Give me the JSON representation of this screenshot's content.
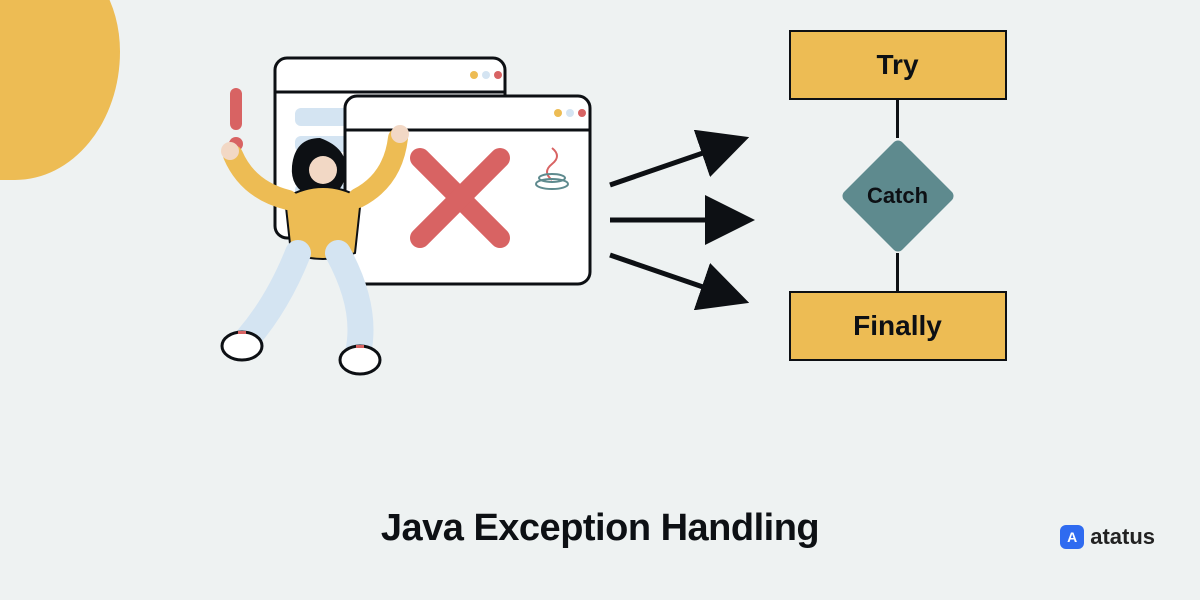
{
  "title": "Java Exception Handling",
  "brand": {
    "name": "atatus",
    "logo_letter": "A"
  },
  "flow": {
    "try_label": "Try",
    "catch_label": "Catch",
    "finally_label": "Finally"
  },
  "illustration": {
    "exclaim_icon": "exclamation-icon",
    "x_icon": "error-x-icon",
    "java_icon": "java-logo-icon",
    "window_dots": [
      "dot",
      "dot",
      "dot"
    ]
  },
  "colors": {
    "accent_yellow": "#edbc54",
    "teal": "#5e8a8e",
    "dark": "#0d1014",
    "pale_blue": "#d4e4f2",
    "bg": "#eef2f2",
    "red": "#d86363"
  }
}
